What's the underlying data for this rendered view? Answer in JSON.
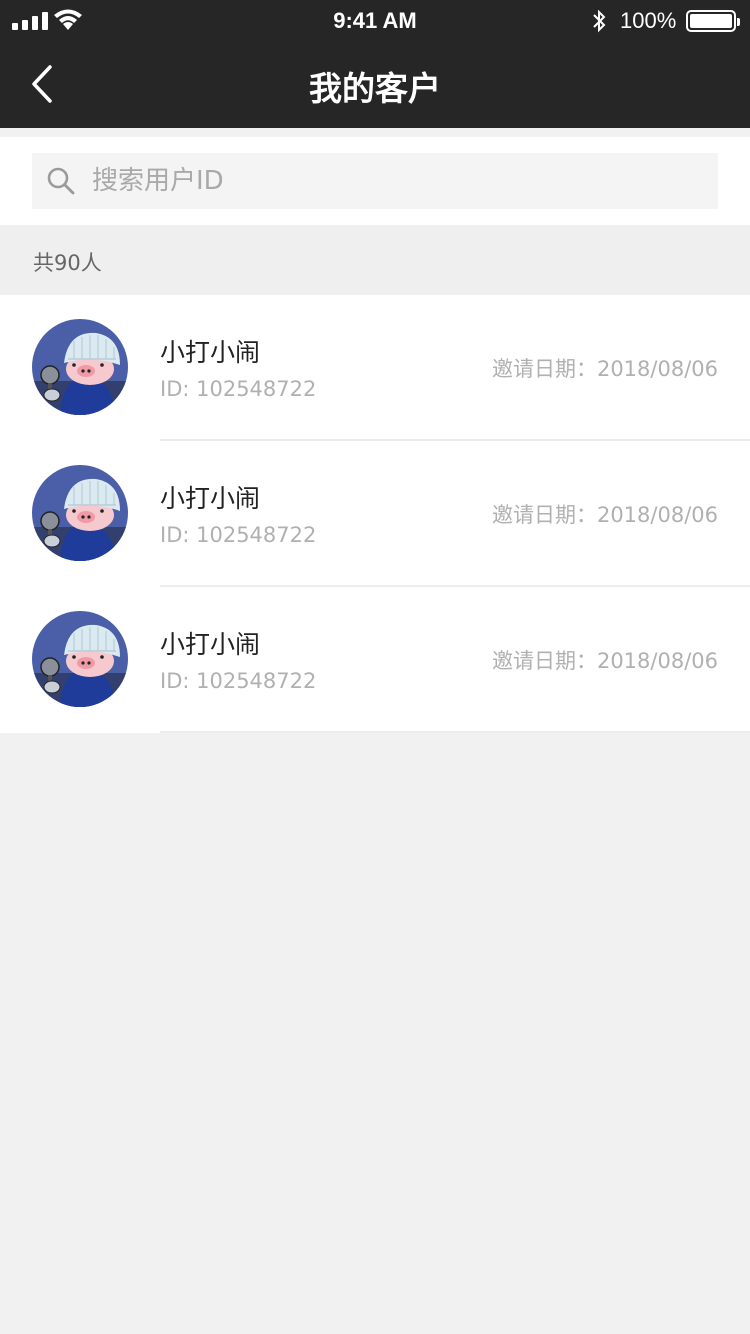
{
  "status_bar": {
    "time": "9:41 AM",
    "battery": "100%"
  },
  "nav": {
    "title": "我的客户",
    "back_icon": "chevron-left-icon"
  },
  "search": {
    "placeholder": "搜索用户ID",
    "value": "",
    "icon": "search-icon"
  },
  "summary": {
    "count_text": "共90人"
  },
  "customers": [
    {
      "name": "小打小闹",
      "id_text": "ID: 102548722",
      "invite_label": "邀请日期：",
      "invite_date": "2018/08/06"
    },
    {
      "name": "小打小闹",
      "id_text": "ID: 102548722",
      "invite_label": "邀请日期：",
      "invite_date": "2018/08/06"
    },
    {
      "name": "小打小闹",
      "id_text": "ID: 102548722",
      "invite_label": "邀请日期：",
      "invite_date": "2018/08/06"
    }
  ],
  "colors": {
    "header_bg": "#262626",
    "page_bg": "#f1f1f1",
    "avatar_bg": "#4a5fa8"
  }
}
